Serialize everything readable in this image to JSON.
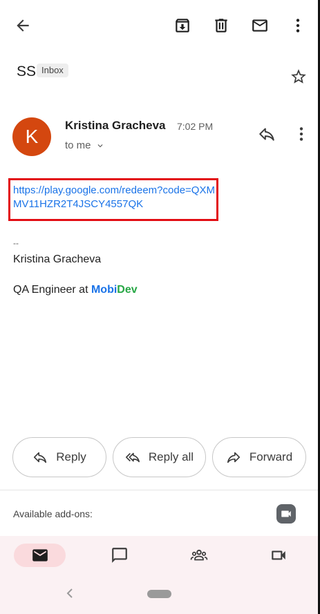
{
  "toolbar": {
    "back_icon": "arrow-back-icon",
    "archive_icon": "archive-icon",
    "delete_icon": "trash-icon",
    "mark_unread_icon": "mail-icon",
    "more_icon": "more-vert-icon"
  },
  "subject": {
    "title": "SS",
    "label": "Inbox",
    "star_icon": "star-outline-icon"
  },
  "sender": {
    "avatar_letter": "K",
    "avatar_color": "#d4470f",
    "name": "Kristina Gracheva",
    "time": "7:02 PM",
    "recipient": "to me"
  },
  "body": {
    "link": "https://play.google.com/redeem?code=QXMMV11HZR2T4JSCY4557QK",
    "highlight_color": "#e20d13",
    "signature_dash": "--",
    "signature_name": "Kristina Gracheva",
    "signature_title_prefix": "QA Engineer at ",
    "brand_part1": "Mobi",
    "brand_part2": "Dev"
  },
  "actions": {
    "reply": "Reply",
    "reply_all": "Reply all",
    "forward": "Forward"
  },
  "addons": {
    "label": "Available add-ons:"
  },
  "nav": {
    "items": [
      "mail-icon",
      "chat-icon",
      "spaces-icon",
      "meet-icon"
    ],
    "active": "mail-icon"
  }
}
